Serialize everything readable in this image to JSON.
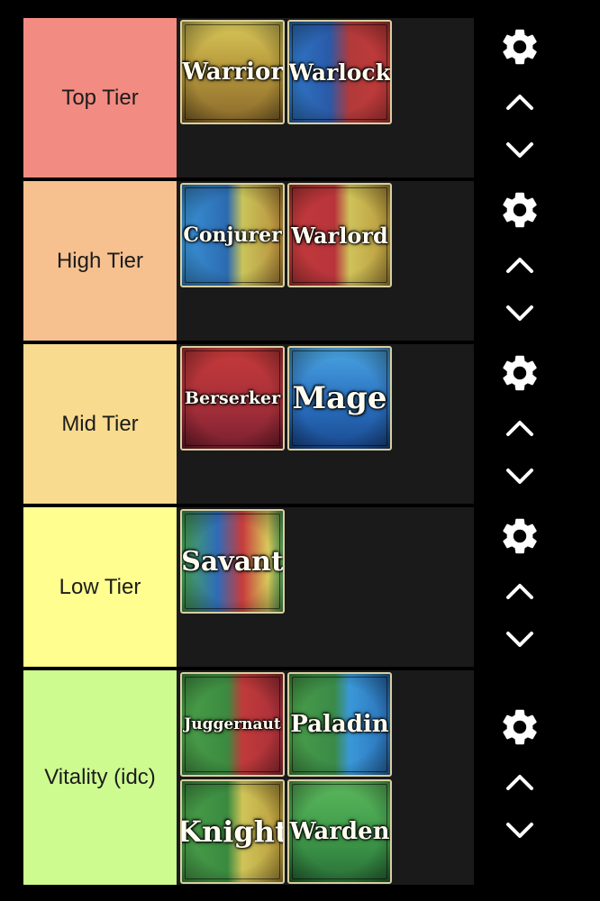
{
  "tiers": [
    {
      "label": "Top Tier",
      "color": "#f28b82",
      "items": [
        {
          "name": "Warrior",
          "bg": "linear-gradient(180deg,#d8c75a 0%,#b89a3c 45%,#8a6a2c 100%)"
        },
        {
          "name": "Warlock",
          "bg": "linear-gradient(90deg,#2f78c8 0%,#2a5aa8 40%,#b23a3a 60%,#c43a3a 100%)"
        }
      ]
    },
    {
      "label": "High Tier",
      "color": "#f6c08f",
      "items": [
        {
          "name": "Conjurer",
          "bg": "linear-gradient(90deg,#3a94d8 0%,#2c6ab0 45%,#c9c45a 60%,#b88c3a 100%)"
        },
        {
          "name": "Warlord",
          "bg": "linear-gradient(90deg,#c23a3a 0%,#b8343c 45%,#cfc25a 60%,#b8983c 100%)"
        }
      ]
    },
    {
      "label": "Mid Tier",
      "color": "#f8db8e",
      "items": [
        {
          "name": "Berserker",
          "bg": "linear-gradient(180deg,#c63a3a 0%,#a8303a 55%,#7a2030 100%)"
        },
        {
          "name": "Mage",
          "bg": "linear-gradient(180deg,#4aa4e0 0%,#2a70c0 55%,#1a4a90 100%)"
        }
      ]
    },
    {
      "label": "Low Tier",
      "color": "#fffe8f",
      "items": [
        {
          "name": "Savant",
          "bg": "linear-gradient(90deg,#4aa858 0%,#2e6cb8 35%,#c83c3c 60%,#d8c85a 85%,#5aa85a 100%)"
        }
      ]
    },
    {
      "label": "Vitality (idc)",
      "color": "#cdfb90",
      "items": [
        {
          "name": "Juggernaut",
          "bg": "linear-gradient(90deg,#4aa04a 0%,#3c8a40 45%,#c03a3a 60%,#a8303a 100%)"
        },
        {
          "name": "Paladin",
          "bg": "linear-gradient(90deg,#4aa04a 0%,#3a8a48 45%,#3a98d8 60%,#2a70b8 100%)"
        },
        {
          "name": "Knight",
          "bg": "linear-gradient(90deg,#4aa04a 0%,#3a8a40 45%,#d0c458 60%,#b89a3c 100%)"
        },
        {
          "name": "Warden",
          "bg": "linear-gradient(180deg,#5cb85c 0%,#3e9a4a 55%,#2a7038 100%)"
        }
      ]
    }
  ],
  "icons": {
    "settings": "gear-icon",
    "up": "chevron-up-icon",
    "down": "chevron-down-icon"
  }
}
